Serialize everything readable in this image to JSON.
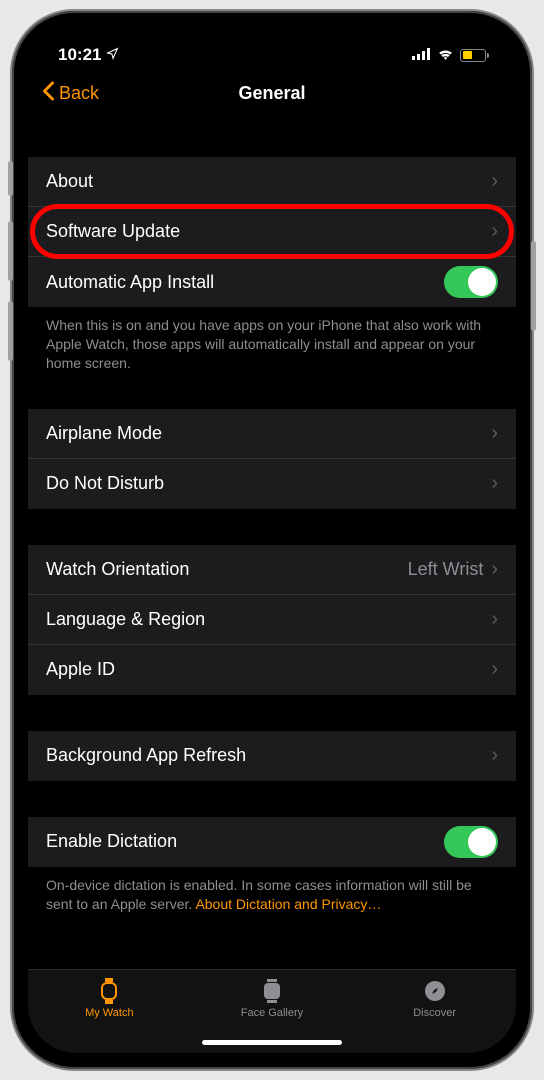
{
  "status": {
    "time": "10:21"
  },
  "nav": {
    "back": "Back",
    "title": "General"
  },
  "rows": {
    "about": "About",
    "software_update": "Software Update",
    "auto_install": "Automatic App Install",
    "auto_install_footer": "When this is on and you have apps on your iPhone that also work with Apple Watch, those apps will automatically install and appear on your home screen.",
    "airplane": "Airplane Mode",
    "dnd": "Do Not Disturb",
    "orientation": "Watch Orientation",
    "orientation_value": "Left Wrist",
    "language": "Language & Region",
    "apple_id": "Apple ID",
    "bg_refresh": "Background App Refresh",
    "dictation": "Enable Dictation",
    "dictation_footer_a": "On-device dictation is enabled. In some cases information will still be sent to an Apple server. ",
    "dictation_footer_link": "About Dictation and Privacy…"
  },
  "tabs": {
    "my_watch": "My Watch",
    "face_gallery": "Face Gallery",
    "discover": "Discover"
  }
}
